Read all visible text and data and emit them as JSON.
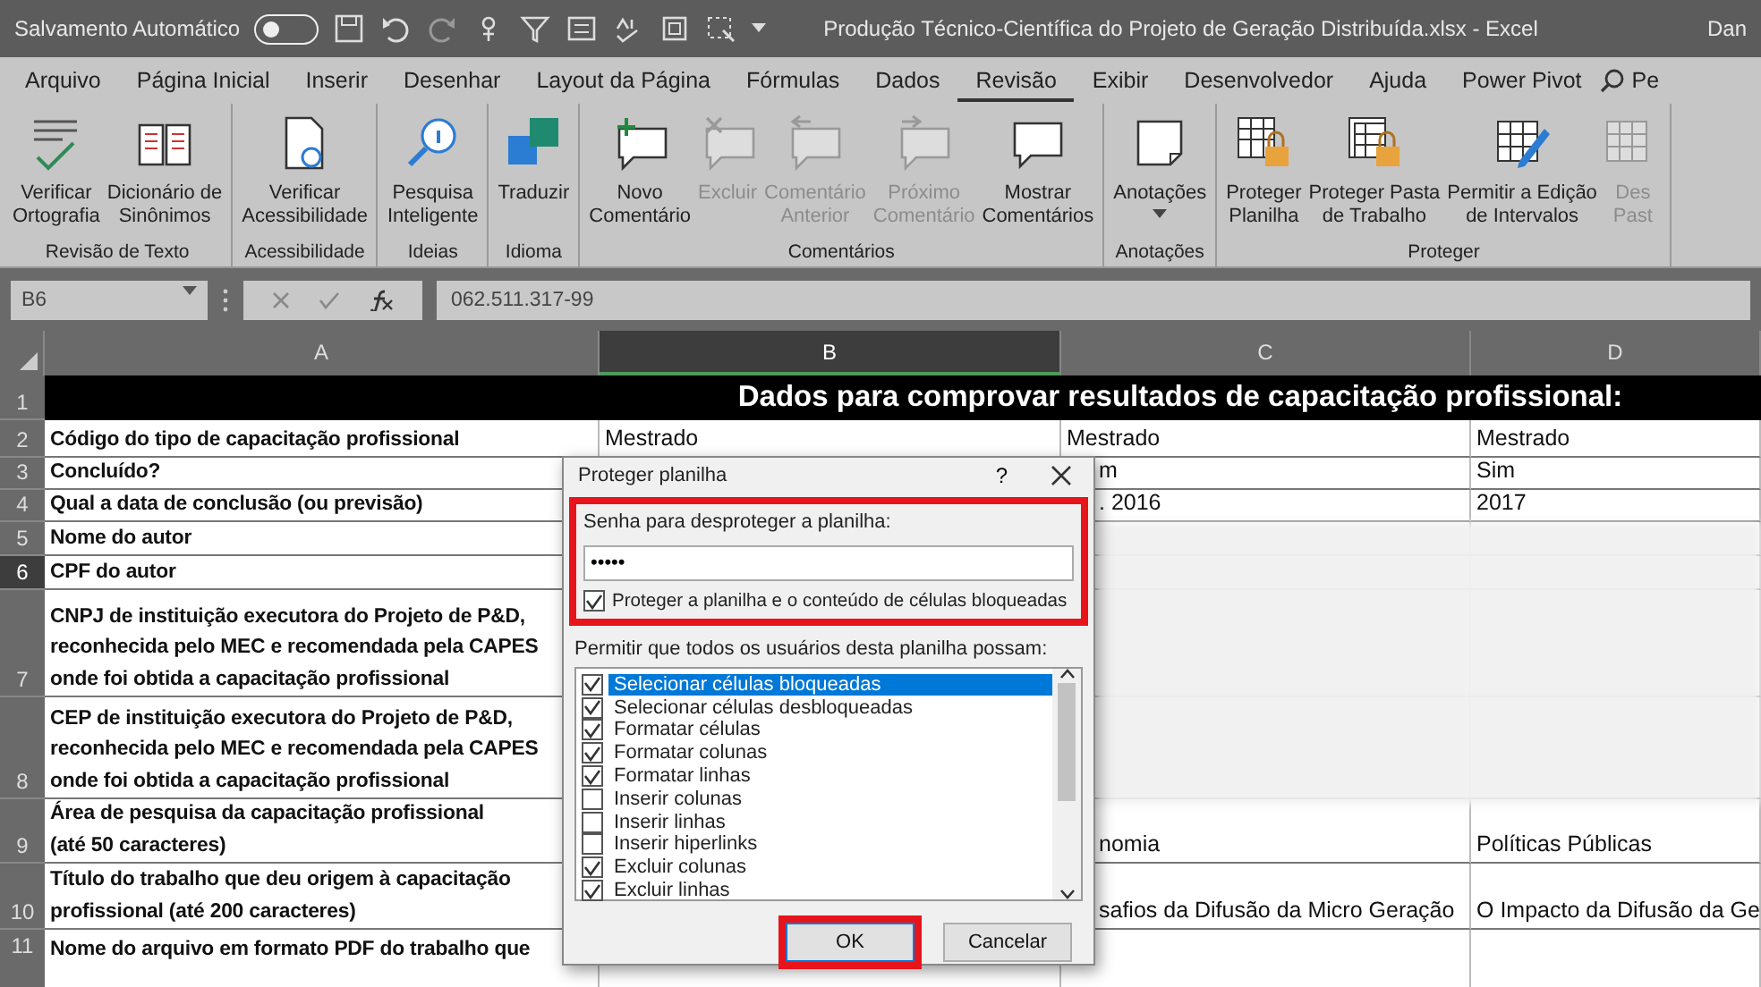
{
  "title_bar": {
    "autosave_label": "Salvamento Automático",
    "autosave_on": false,
    "title": "Produção Técnico-Científica do Projeto de Geração Distribuída.xlsx  -  Excel",
    "user": "Dan"
  },
  "ribbon_tabs": [
    {
      "label": "Arquivo",
      "selected": false
    },
    {
      "label": "Página Inicial",
      "selected": false
    },
    {
      "label": "Inserir",
      "selected": false
    },
    {
      "label": "Desenhar",
      "selected": false
    },
    {
      "label": "Layout da Página",
      "selected": false
    },
    {
      "label": "Fórmulas",
      "selected": false
    },
    {
      "label": "Dados",
      "selected": false
    },
    {
      "label": "Revisão",
      "selected": true
    },
    {
      "label": "Exibir",
      "selected": false
    },
    {
      "label": "Desenvolvedor",
      "selected": false
    },
    {
      "label": "Ajuda",
      "selected": false
    },
    {
      "label": "Power Pivot",
      "selected": false
    }
  ],
  "ribbon_search_partial": "Pe",
  "ribbon_groups": [
    {
      "name": "Revisão de Texto",
      "buttons": [
        {
          "label": "Verificar\nOrtografia",
          "disabled": false,
          "has_menu": false
        },
        {
          "label": "Dicionário de\nSinônimos",
          "disabled": false,
          "has_menu": false
        }
      ]
    },
    {
      "name": "Acessibilidade",
      "buttons": [
        {
          "label": "Verificar\nAcessibilidade",
          "disabled": false,
          "has_menu": false
        }
      ]
    },
    {
      "name": "Ideias",
      "buttons": [
        {
          "label": "Pesquisa\nInteligente",
          "disabled": false,
          "has_menu": false
        }
      ]
    },
    {
      "name": "Idioma",
      "buttons": [
        {
          "label": "Traduzir",
          "disabled": false,
          "has_menu": false
        }
      ]
    },
    {
      "name": "Comentários",
      "buttons": [
        {
          "label": "Novo\nComentário",
          "disabled": false,
          "has_menu": false
        },
        {
          "label": "Excluir",
          "disabled": true,
          "has_menu": false
        },
        {
          "label": "Comentário\nAnterior",
          "disabled": true,
          "has_menu": false
        },
        {
          "label": "Próximo\nComentário",
          "disabled": true,
          "has_menu": false
        },
        {
          "label": "Mostrar\nComentários",
          "disabled": false,
          "has_menu": false
        }
      ]
    },
    {
      "name": "Anotações",
      "buttons": [
        {
          "label": "Anotações",
          "disabled": false,
          "has_menu": true
        }
      ]
    },
    {
      "name": "Proteger",
      "buttons": [
        {
          "label": "Proteger\nPlanilha",
          "disabled": false,
          "has_menu": false
        },
        {
          "label": "Proteger Pasta\nde Trabalho",
          "disabled": false,
          "has_menu": false
        },
        {
          "label": "Permitir a Edição\nde Intervalos",
          "disabled": false,
          "has_menu": false
        },
        {
          "label": "Des\nPast",
          "disabled": true,
          "has_menu": false
        }
      ]
    }
  ],
  "formula_bar": {
    "name_box": "B6",
    "value": "062.511.317-99"
  },
  "sheet": {
    "columns": [
      {
        "label": "A",
        "selected": false
      },
      {
        "label": "B",
        "selected": true
      },
      {
        "label": "C",
        "selected": false
      },
      {
        "label": "D",
        "selected": false
      }
    ],
    "rows": [
      {
        "number": "1",
        "selected": false,
        "kind": "title",
        "title": "Dados para comprovar resultados de capacitação profissional:"
      },
      {
        "number": "2",
        "selected": false,
        "kind": "data",
        "cells": {
          "A": "Código do tipo de capacitação profissional",
          "B": "Mestrado",
          "C": "Mestrado",
          "D": "Mestrado"
        }
      },
      {
        "number": "3",
        "selected": false,
        "kind": "data",
        "cells": {
          "A": "Concluído?",
          "C": "m",
          "D": "Sim"
        }
      },
      {
        "number": "4",
        "selected": false,
        "kind": "data",
        "cells": {
          "A": "Qual a data de conclusão (ou previsão)",
          "C": ". 2016",
          "D": "2017"
        }
      },
      {
        "number": "5",
        "selected": false,
        "kind": "data",
        "cells": {
          "A": "Nome do autor"
        }
      },
      {
        "number": "6",
        "selected": true,
        "kind": "data",
        "cells": {
          "A": "CPF do autor"
        }
      },
      {
        "number": "7",
        "selected": false,
        "kind": "data",
        "cells": {
          "A": "CNPJ de instituição executora do Projeto de P&D,\nreconhecida pelo MEC e recomendada pela CAPES\nonde foi obtida a capacitação profissional"
        }
      },
      {
        "number": "8",
        "selected": false,
        "kind": "data",
        "cells": {
          "A": "CEP de instituição executora do Projeto de P&D,\nreconhecida pelo MEC e recomendada pela CAPES\nonde foi obtida a capacitação profissional"
        }
      },
      {
        "number": "9",
        "selected": false,
        "kind": "data",
        "cells": {
          "A": "Área de pesquisa da capacitação profissional\n(até 50 caracteres)",
          "C": "nomia",
          "D": "Políticas Públicas"
        }
      },
      {
        "number": "10",
        "selected": false,
        "kind": "data",
        "cells": {
          "A": "Título do trabalho que deu origem à capacitação\nprofissional (até 200 caracteres)",
          "C": "safios da Difusão da Micro Geração",
          "D": "O Impacto da Difusão da Ge"
        }
      },
      {
        "number": "11",
        "selected": false,
        "kind": "data",
        "cells": {
          "A": "Nome do arquivo em formato PDF do trabalho que"
        }
      }
    ]
  },
  "dialog": {
    "title": "Proteger planilha",
    "help": "?",
    "password_label": "Senha para desproteger a planilha:",
    "password_value": "•••••",
    "password_highlighted": true,
    "protect_checkbox": {
      "label": "Proteger a planilha e o conteúdo de células bloqueadas",
      "checked": true
    },
    "permissions_label": "Permitir que todos os usuários desta planilha possam:",
    "permissions": [
      {
        "label": "Selecionar células bloqueadas",
        "checked": true,
        "selected": true
      },
      {
        "label": "Selecionar células desbloqueadas",
        "checked": true,
        "selected": false
      },
      {
        "label": "Formatar células",
        "checked": true,
        "selected": false
      },
      {
        "label": "Formatar colunas",
        "checked": true,
        "selected": false
      },
      {
        "label": "Formatar linhas",
        "checked": true,
        "selected": false
      },
      {
        "label": "Inserir colunas",
        "checked": false,
        "selected": false
      },
      {
        "label": "Inserir linhas",
        "checked": false,
        "selected": false
      },
      {
        "label": "Inserir hiperlinks",
        "checked": false,
        "selected": false
      },
      {
        "label": "Excluir colunas",
        "checked": true,
        "selected": false
      },
      {
        "label": "Excluir linhas",
        "checked": true,
        "selected": false
      }
    ],
    "buttons": [
      {
        "label": "OK",
        "kind": "primary",
        "highlighted": true
      },
      {
        "label": "Cancelar",
        "kind": "secondary",
        "highlighted": false
      }
    ]
  }
}
